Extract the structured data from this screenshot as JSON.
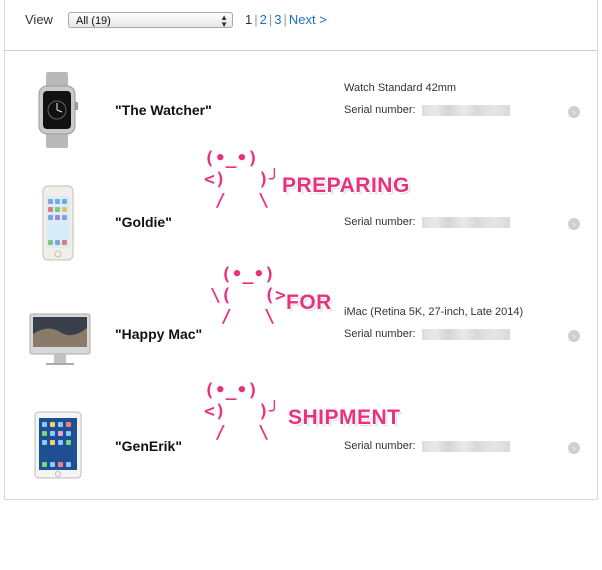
{
  "toolbar": {
    "view_label": "View",
    "filter_value": "All (19)",
    "pages": {
      "current": "1",
      "page2": "2",
      "page3": "3",
      "sep": "|",
      "next": "Next >"
    }
  },
  "devices": [
    {
      "name": "\"The Watcher\"",
      "model": "Watch Standard 42mm",
      "serial_label": "Serial number:",
      "icon": "apple-watch-icon"
    },
    {
      "name": "\"Goldie\"",
      "model": "",
      "serial_label": "Serial number:",
      "icon": "iphone-icon"
    },
    {
      "name": "\"Happy Mac\"",
      "model": "iMac (Retina 5K, 27-inch, Late 2014)",
      "serial_label": "Serial number:",
      "icon": "imac-icon"
    },
    {
      "name": "\"GenErik\"",
      "model": "",
      "serial_label": "Serial number:",
      "icon": "ipad-icon"
    }
  ],
  "overlay": {
    "kaomoji_1": "(•_•)\n<)   )╯\n /   \\",
    "kaomoji_2": " (•_•)\n\\(   (>\n /   \\",
    "kaomoji_3": "(•_•)\n<)   )╯\n /   \\",
    "word_1": "PREPARING",
    "word_2": "FOR",
    "word_3": "SHIPMENT",
    "accent": "#e8327d"
  }
}
